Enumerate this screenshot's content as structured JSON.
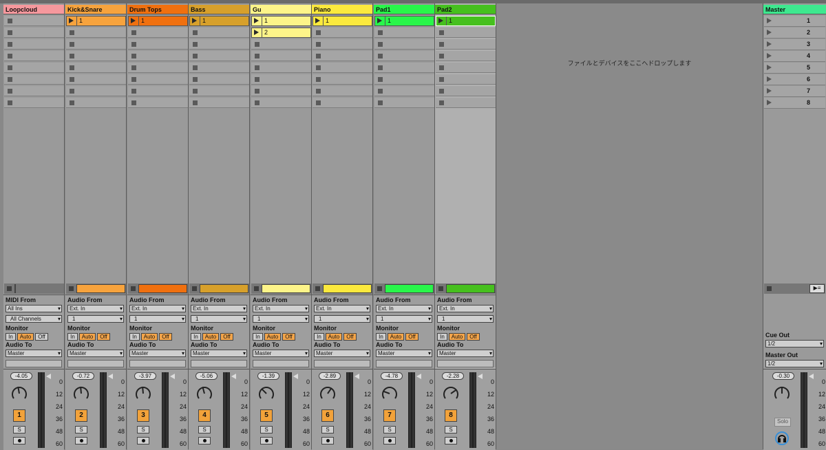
{
  "tracks": [
    {
      "name": "Loopcloud",
      "color": "#f6989d",
      "io_from": "MIDI From",
      "input": "All Ins",
      "channel": "All Channels",
      "volume": "-4.05",
      "number": "1",
      "clips": []
    },
    {
      "name": "Kick&Snare",
      "color": "#f7a33d",
      "io_from": "Audio From",
      "input": "Ext. In",
      "channel": "1",
      "volume": "-0.72",
      "number": "2",
      "clips": [
        "1"
      ]
    },
    {
      "name": "Drum Tops",
      "color": "#f0700f",
      "io_from": "Audio From",
      "input": "Ext. In",
      "channel": "1",
      "volume": "-3.97",
      "number": "3",
      "clips": [
        "1"
      ]
    },
    {
      "name": "Bass",
      "color": "#d7a02b",
      "io_from": "Audio From",
      "input": "Ext. In",
      "channel": "1",
      "volume": "-5.06",
      "number": "4",
      "clips": [
        "1"
      ]
    },
    {
      "name": "Gu",
      "color": "#fdf489",
      "io_from": "Audio From",
      "input": "Ext. In",
      "channel": "1",
      "volume": "-1.39",
      "number": "5",
      "clips": [
        "1",
        "2"
      ]
    },
    {
      "name": "Piano",
      "color": "#fbe93d",
      "io_from": "Audio From",
      "input": "Ext. In",
      "channel": "1",
      "volume": "-2.89",
      "number": "6",
      "clips": [
        "1"
      ]
    },
    {
      "name": "Pad1",
      "color": "#29f64a",
      "io_from": "Audio From",
      "input": "Ext. In",
      "channel": "1",
      "volume": "-4.78",
      "number": "7",
      "clips": [
        "1"
      ]
    },
    {
      "name": "Pad2",
      "color": "#46c01e",
      "io_from": "Audio From",
      "input": "Ext. In",
      "channel": "1",
      "volume": "-2.28",
      "number": "8",
      "clips": [
        "1"
      ]
    }
  ],
  "labels": {
    "monitor": "Monitor",
    "monitor_in": "In",
    "monitor_auto": "Auto",
    "monitor_off": "Off",
    "audio_to": "Audio To",
    "audio_to_value": "Master",
    "solo": "S",
    "scale": [
      "0",
      "12",
      "24",
      "36",
      "48",
      "60"
    ]
  },
  "drop_zone": {
    "text": "ファイルとデバイスをここへドロップします"
  },
  "master": {
    "name": "Master",
    "color": "#3ee88f",
    "scenes": [
      "1",
      "2",
      "3",
      "4",
      "5",
      "6",
      "7",
      "8"
    ],
    "cue_out_label": "Cue Out",
    "cue_out_value": "1/2",
    "master_out_label": "Master Out",
    "master_out_value": "1/2",
    "volume": "-0.30",
    "solo_label": "Solo"
  }
}
